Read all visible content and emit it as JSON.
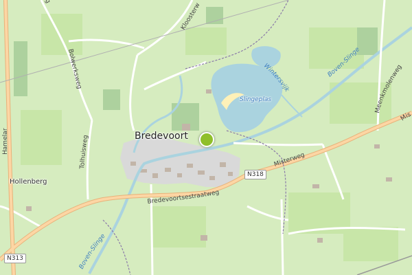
{
  "map": {
    "places": {
      "town": "Bredevoort",
      "village": "Hollenberg"
    },
    "water": {
      "lake": "Slingeplas",
      "river_east": "Boven-Slinge",
      "river_southwest": "Boven-Slinge",
      "stream": "Wintersvijk"
    },
    "roads": {
      "misterweg": "Misterweg",
      "bredevoortsestraatweg": "Bredevoortsestraatweg",
      "bolwerksweg": "Bolwerksweg",
      "tolhuisweg": "Tolhuisweg",
      "kloosterweg": "Kloosterweg",
      "meenkmolenweg": "Meenkmolenweg",
      "hamelar": "Hamelar",
      "east_edge": "Mis",
      "top_edge": "g"
    },
    "shields": {
      "n318": "N318",
      "n313": "N313"
    },
    "marker": {
      "color": "#8fbf2a"
    },
    "colors": {
      "background": "#d6ecbf",
      "water": "#aad3df",
      "primary_road": "#fcd6a4",
      "town_fill": "#d9d9d9"
    }
  }
}
